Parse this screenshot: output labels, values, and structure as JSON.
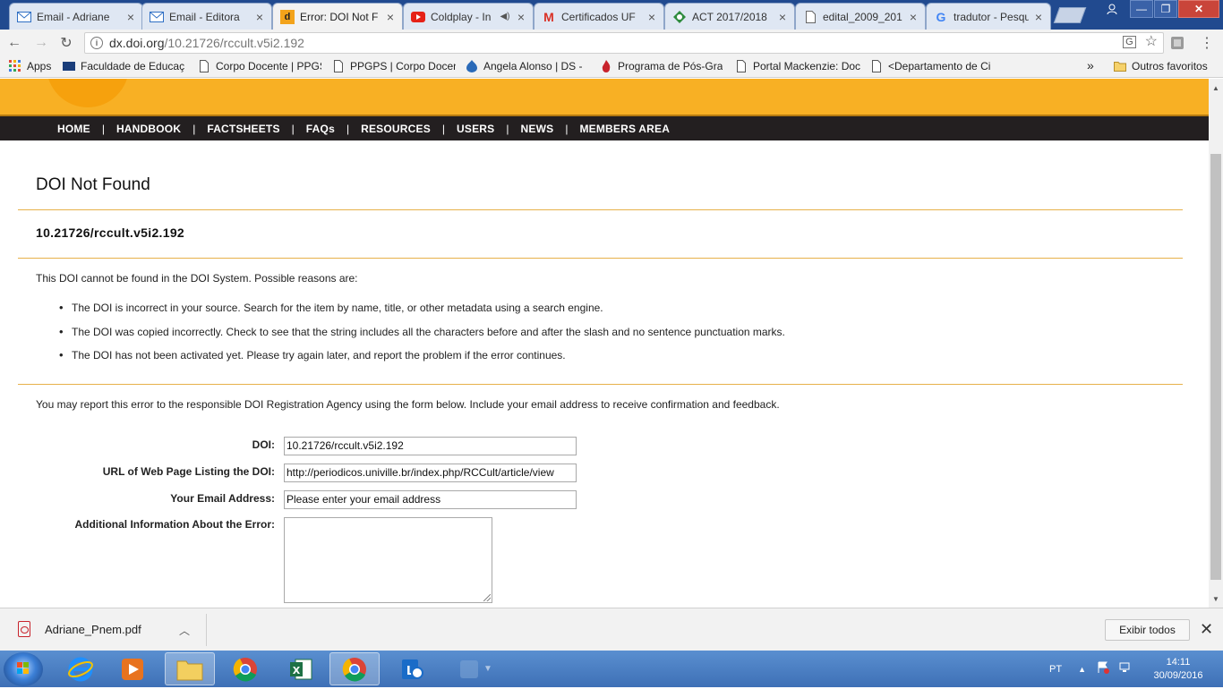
{
  "browser": {
    "tabs": [
      {
        "label": "Email - Adriane",
        "icon": "outlook-icon"
      },
      {
        "label": "Email - Editora",
        "icon": "outlook-icon"
      },
      {
        "label": "Error: DOI Not F",
        "icon": "doi-icon",
        "active": true
      },
      {
        "label": "Coldplay - In",
        "icon": "youtube-icon"
      },
      {
        "label": "Certificados UF",
        "icon": "gmail-icon"
      },
      {
        "label": "ACT 2017/2018",
        "icon": "act-icon"
      },
      {
        "label": "edital_2009_201",
        "icon": "document-icon"
      },
      {
        "label": "tradutor - Pesqu",
        "icon": "google-icon"
      }
    ],
    "url_host": "dx.doi.org",
    "url_path": "/10.21726/rccult.v5i2.192",
    "bookmarks": [
      {
        "label": "Apps"
      },
      {
        "label": "Faculdade de Educaç"
      },
      {
        "label": "Corpo Docente | PPGS"
      },
      {
        "label": "PPGPS | Corpo Docen"
      },
      {
        "label": "Angela Alonso | DS -"
      },
      {
        "label": "Programa de Pós-Gra"
      },
      {
        "label": "Portal Mackenzie: Doc"
      },
      {
        "label": "<Departamento de Ci"
      },
      {
        "label": "»"
      },
      {
        "label": "Outros favoritos"
      }
    ]
  },
  "site": {
    "nav": [
      "HOME",
      "HANDBOOK",
      "FACTSHEETS",
      "FAQs",
      "RESOURCES",
      "USERS",
      "NEWS",
      "MEMBERS AREA"
    ],
    "nav_separator": "|"
  },
  "page": {
    "title": "DOI Not Found",
    "doi": "10.21726/rccult.v5i2.192",
    "intro": "This DOI cannot be found in the DOI System. Possible reasons are:",
    "reasons": [
      "The DOI is incorrect in your source. Search for the item by name, title, or other metadata using a search engine.",
      "The DOI was copied incorrectly. Check to see that the string includes all the characters before and after the slash and no sentence punctuation marks.",
      "The DOI has not been activated yet. Please try again later, and report the problem if the error continues."
    ],
    "report_text": "You may report this error to the responsible DOI Registration Agency using the form below. Include your email address to receive confirmation and feedback."
  },
  "form": {
    "doi_label": "DOI:",
    "doi_value": "10.21726/rccult.v5i2.192",
    "url_label": "URL of Web Page Listing the DOI:",
    "url_value": "http://periodicos.univille.br/index.php/RCCult/article/view",
    "email_label": "Your Email Address:",
    "email_value": "Please enter your email address",
    "info_label": "Additional Information About the Error:",
    "info_value": ""
  },
  "downloads": {
    "file": "Adriane_Pnem.pdf",
    "show_all": "Exibir todos"
  },
  "taskbar": {
    "lang": "PT",
    "time": "14:11",
    "date": "30/09/2016"
  }
}
